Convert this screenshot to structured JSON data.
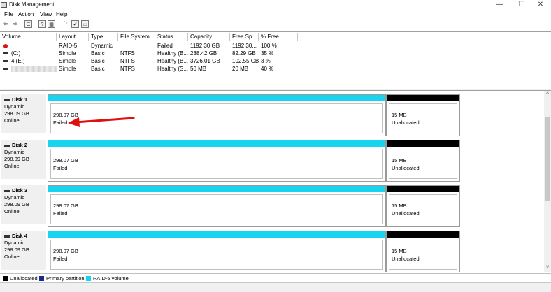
{
  "window": {
    "title": "Disk Management",
    "minimize": "—",
    "maximize": "❐",
    "close": "✕"
  },
  "menu": [
    "File",
    "Action",
    "View",
    "Help"
  ],
  "toolbar": {
    "back_icon": "⇦",
    "forward_icon": "⇨",
    "list_icon": "☰",
    "help_icon": "?",
    "grid_icon": "▦",
    "props_icon": "⚐",
    "check_icon": "✔",
    "view_icon": "▭"
  },
  "volume_list": {
    "columns": [
      "Volume",
      "Layout",
      "Type",
      "File System",
      "Status",
      "Capacity",
      "Free Sp...",
      "% Free"
    ],
    "rows": [
      {
        "volume": "",
        "icon": "failed",
        "layout": "RAID-5",
        "type": "Dynamic",
        "fs": "",
        "status": "Failed",
        "capacity": "1192.30 GB",
        "free": "1192.30...",
        "pct": "100 %"
      },
      {
        "volume": "(C:)",
        "icon": "drive",
        "layout": "Simple",
        "type": "Basic",
        "fs": "NTFS",
        "status": "Healthy (B...",
        "capacity": "238.42 GB",
        "free": "82.29 GB",
        "pct": "35 %"
      },
      {
        "volume": "4 (E:)",
        "icon": "drive",
        "layout": "Simple",
        "type": "Basic",
        "fs": "NTFS",
        "status": "Healthy (B...",
        "capacity": "3726.01 GB",
        "free": "102.55 GB",
        "pct": "3 %"
      },
      {
        "volume": "",
        "icon": "blurred",
        "layout": "Simple",
        "type": "Basic",
        "fs": "NTFS",
        "status": "Healthy (S...",
        "capacity": "50 MB",
        "free": "20 MB",
        "pct": "40 %"
      }
    ]
  },
  "disks": [
    {
      "name": "Disk 1",
      "kind": "Dynamic",
      "size": "298.09 GB",
      "state": "Online",
      "raid_size": "298.07 GB",
      "raid_status": "Failed",
      "unalloc_size": "15 MB",
      "unalloc_label": "Unallocated"
    },
    {
      "name": "Disk 2",
      "kind": "Dynamic",
      "size": "298.09 GB",
      "state": "Online",
      "raid_size": "298.07 GB",
      "raid_status": "Failed",
      "unalloc_size": "15 MB",
      "unalloc_label": "Unallocated"
    },
    {
      "name": "Disk 3",
      "kind": "Dynamic",
      "size": "298.09 GB",
      "state": "Online",
      "raid_size": "298.07 GB",
      "raid_status": "Failed",
      "unalloc_size": "15 MB",
      "unalloc_label": "Unallocated"
    },
    {
      "name": "Disk 4",
      "kind": "Dynamic",
      "size": "298.09 GB",
      "state": "Online",
      "raid_size": "298.07 GB",
      "raid_status": "Failed",
      "unalloc_size": "15 MB",
      "unalloc_label": "Unallocated"
    }
  ],
  "legend": [
    {
      "label": "Unallocated",
      "color": "#000000"
    },
    {
      "label": "Primary partition",
      "color": "#1a2a8c"
    },
    {
      "label": "RAID-5 volume",
      "color": "#19d4ee"
    }
  ],
  "colors": {
    "raid_bar": "#19d4ee",
    "unalloc_bar": "#000000",
    "annotation_arrow": "#e01010"
  },
  "scroll": {
    "up": "˄",
    "down": "˅"
  }
}
